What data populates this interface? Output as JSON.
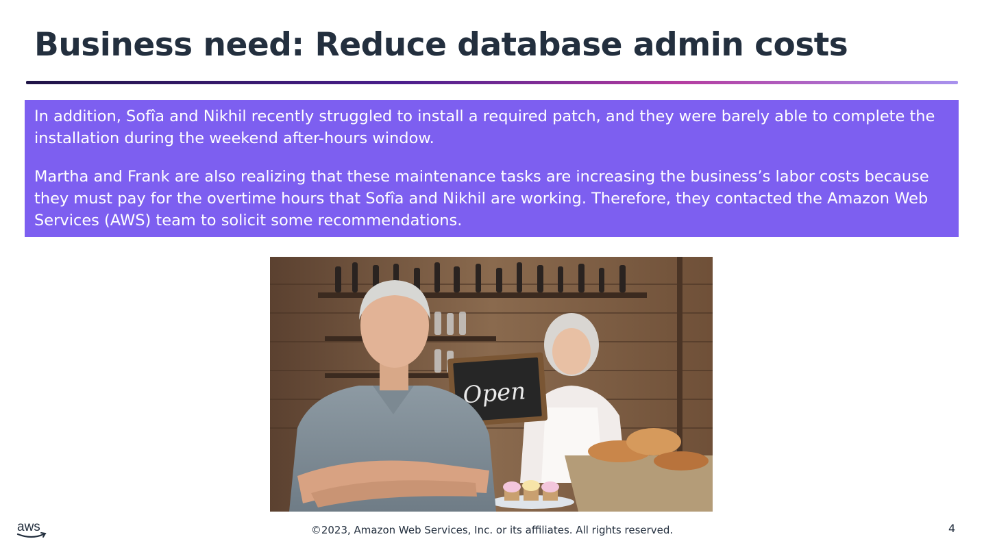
{
  "slide": {
    "title": "Business need: Reduce database admin costs",
    "paragraphs": [
      "In addition, Sofîa and Nikhil recently struggled to install a required patch, and they were barely able to complete the installation during the weekend after-hours window.",
      "Martha and Frank are also realizing that these maintenance tasks are increasing the business’s labor costs because they must pay for the overtime hours that Sofîa and Nikhil are working. Therefore, they contacted the Amazon Web Services (AWS) team to solicit some recommendations."
    ],
    "photo_sign_text": "Open",
    "accent_color": "#7d5ff0",
    "title_color": "#232f3e"
  },
  "footer": {
    "logo_text": "aws",
    "copyright": "©2023, Amazon Web Services, Inc. or its affiliates. All rights reserved.",
    "page_number": "4"
  }
}
